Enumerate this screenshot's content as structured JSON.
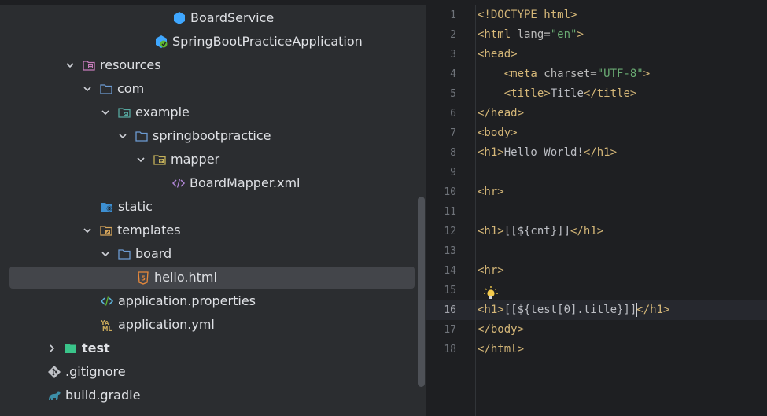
{
  "project_tree": {
    "rows": [
      {
        "label": "BoardService",
        "icon": "spring-service-icon"
      },
      {
        "label": "SpringBootPracticeApplication",
        "icon": "spring-boot-app-icon"
      },
      {
        "label": "resources",
        "icon": "resources-folder-icon",
        "expanded": true
      },
      {
        "label": "com",
        "icon": "package-folder-icon",
        "expanded": true
      },
      {
        "label": "example",
        "icon": "package-folder-icon",
        "expanded": true
      },
      {
        "label": "springbootpractice",
        "icon": "folder-icon",
        "expanded": true
      },
      {
        "label": "mapper",
        "icon": "folder-icon",
        "expanded": true
      },
      {
        "label": "BoardMapper.xml",
        "icon": "xml-file-icon"
      },
      {
        "label": "static",
        "icon": "web-folder-icon"
      },
      {
        "label": "templates",
        "icon": "templates-folder-icon",
        "expanded": true
      },
      {
        "label": "board",
        "icon": "folder-icon",
        "expanded": true
      },
      {
        "label": "hello.html",
        "icon": "html5-file-icon",
        "selected": true
      },
      {
        "label": "application.properties",
        "icon": "properties-file-icon"
      },
      {
        "label": "application.yml",
        "icon": "yaml-file-icon"
      },
      {
        "label": "test",
        "icon": "test-folder-icon",
        "expanded": false
      },
      {
        "label": ".gitignore",
        "icon": "git-icon"
      },
      {
        "label": "build.gradle",
        "icon": "gradle-icon"
      }
    ]
  },
  "editor": {
    "line_numbers": [
      "1",
      "2",
      "3",
      "4",
      "5",
      "6",
      "7",
      "8",
      "9",
      "10",
      "11",
      "12",
      "13",
      "14",
      "15",
      "16",
      "17",
      "18"
    ],
    "current_line": "16",
    "lines": {
      "l1_tag": "<!DOCTYPE html>",
      "l2_open": "<html ",
      "l2_attr": "lang=",
      "l2_val": "\"en\"",
      "l2_close": ">",
      "l3": "<head>",
      "l4_open": "<meta ",
      "l4_attr": "charset=",
      "l4_val": "\"UTF-8\"",
      "l4_close": ">",
      "l5_open": "<title>",
      "l5_text": "Title",
      "l5_close": "</title>",
      "l6": "</head>",
      "l7": "<body>",
      "l8_open": "<h1>",
      "l8_text": "Hello World!",
      "l8_close": "</h1>",
      "l10": "<hr>",
      "l12_open": "<h1>",
      "l12_text": "[[${cnt}]]",
      "l12_close": "</h1>",
      "l14": "<hr>",
      "l16_open": "<h1>",
      "l16_text": "[[${test[0].title}]]",
      "l16_close": "</h1>",
      "l17": "</body>",
      "l18": "</html>"
    }
  },
  "colors": {
    "tree_bg": "#2b2d30",
    "editor_bg": "#1e1f22",
    "tag": "#d5b778",
    "string": "#6aab73",
    "selection": "#43454a"
  }
}
